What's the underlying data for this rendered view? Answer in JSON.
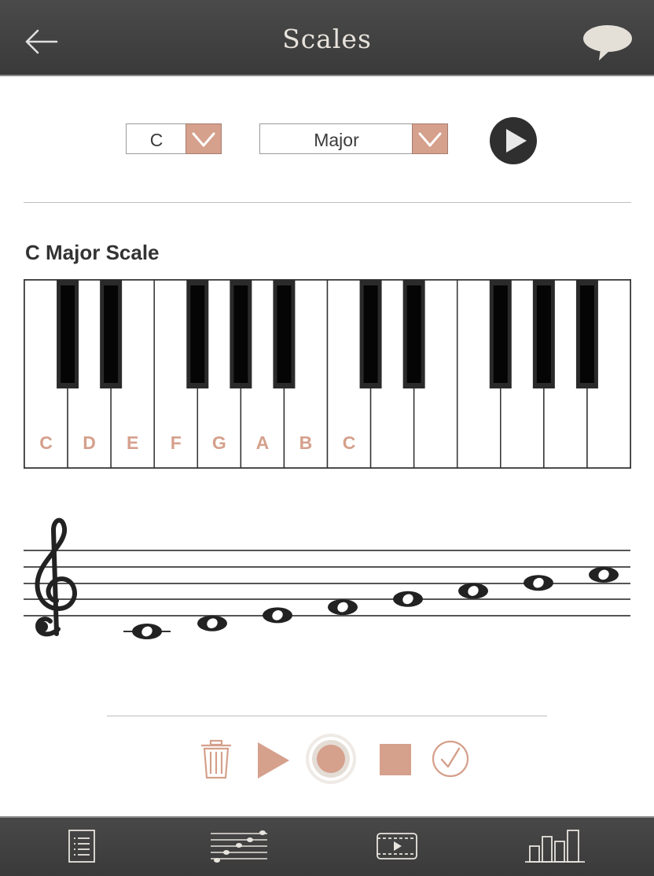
{
  "header": {
    "title": "Scales",
    "back_icon": "back-arrow-icon",
    "chat_icon": "speech-bubble-icon"
  },
  "controls_top": {
    "key_select": {
      "value": "C"
    },
    "scale_select": {
      "value": "Major"
    },
    "accent_color": "#d5a08c"
  },
  "scale_title": "C Major Scale",
  "keyboard": {
    "white_key_labels": [
      "C",
      "D",
      "E",
      "F",
      "G",
      "A",
      "B",
      "C",
      "",
      "",
      "",
      "",
      "",
      ""
    ],
    "label_color": "#d5a08c"
  },
  "recorder": {
    "icons": [
      "trash-icon",
      "play-icon",
      "record-icon",
      "stop-icon",
      "check-icon"
    ]
  },
  "bottom_nav": {
    "tabs": [
      "list-icon",
      "mixer-icon",
      "video-icon",
      "bar-chart-icon"
    ]
  }
}
